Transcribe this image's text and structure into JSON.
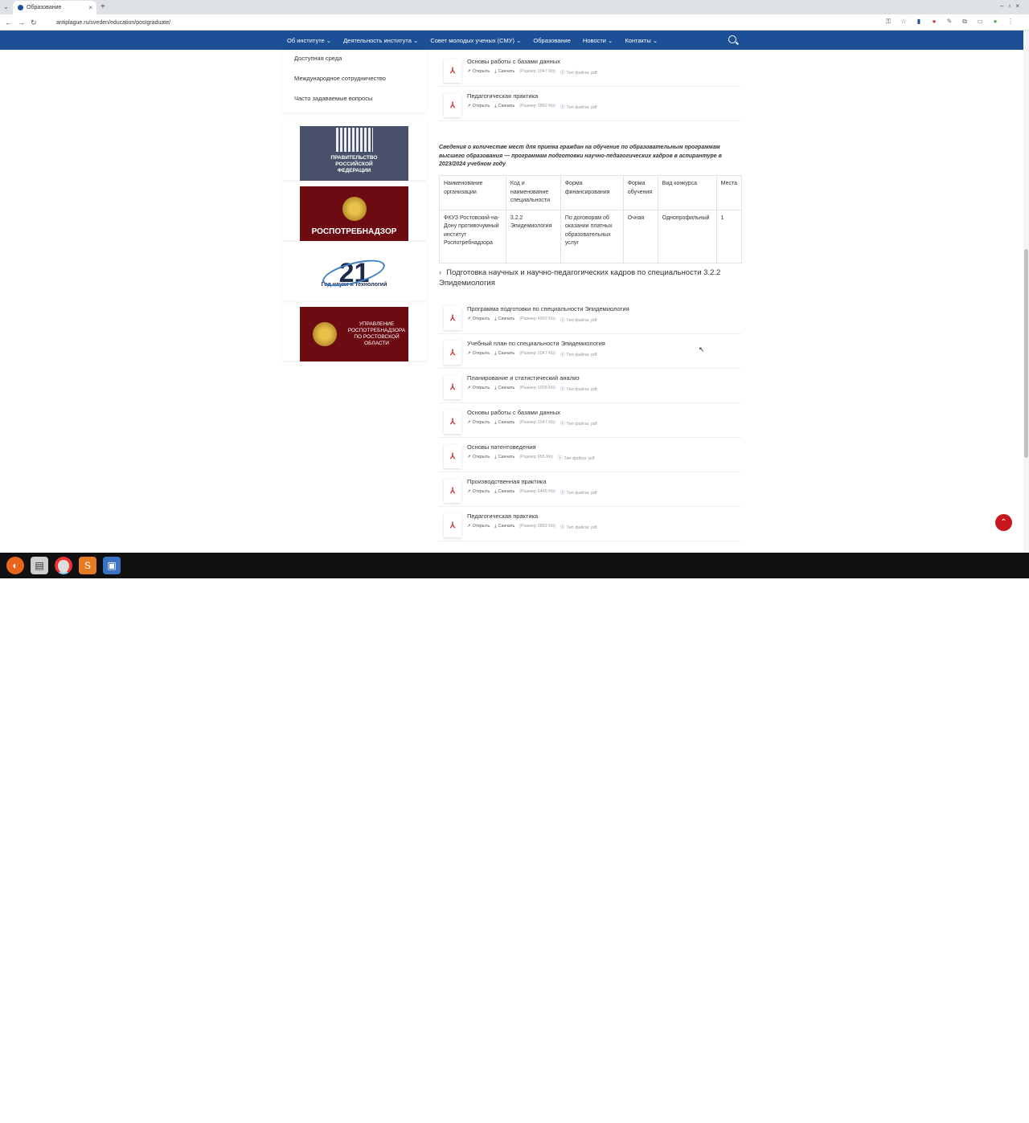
{
  "browser": {
    "tab_title": "Образование",
    "url": "antiplague.ru/sveden/education/postgraduate/"
  },
  "nav": {
    "items": [
      "Об институте",
      "Деятельность института",
      "Совет молодых ученых (СМУ)",
      "Образование",
      "Новости",
      "Контакты"
    ],
    "dropdown_flags": [
      true,
      true,
      true,
      false,
      true,
      true
    ]
  },
  "sidebar": {
    "links": [
      "Доступная среда",
      "Международное сотрудничество",
      "Часто задаваемые вопросы"
    ]
  },
  "banners": {
    "gov": "ПРАВИТЕЛЬСТВО РОССИЙСКОЙ ФЕДЕРАЦИИ",
    "rpn": "РОСПОТРЕБНАДЗОР",
    "year_num": "21",
    "year_text": "Год науки и технологий",
    "upr": "УПРАВЛЕНИЕ РОСПОТРЕБНАДЗОРА ПО РОСТОВСКОЙ ОБЛАСТИ"
  },
  "labels": {
    "open": "Открыть",
    "download": "Скачать",
    "type": "Тип файла: pdf"
  },
  "files_top": [
    {
      "title": "Основы работы с базами данных",
      "size": "(Размер 1047 Kb)"
    },
    {
      "title": "Педагогическая практика",
      "size": "(Размер 3892 Kb)"
    }
  ],
  "note": "Сведения о количестве мест для приема граждан на обучение по образовательным программам высшего образования — программам подготовки научно-педагогических кадров в аспирантуре в 2023/2024 учебном году",
  "table": {
    "headers": [
      "Наименование организации",
      "Код и наименование специальности",
      "Форма финансирования",
      "Форма обучения",
      "Вид конкурса",
      "Места"
    ],
    "row": [
      "ФКУЗ Ростовский-на-Дону противочумный институт Роспотребнадзора",
      "3.2.2 Эпидемиология",
      "По договорам об оказании платных образовательных услуг",
      "Очная",
      "Однопрофильный",
      "1"
    ]
  },
  "section_title": "Подготовка научных и научно-педагогических кадров по специальности 3.2.2 Эпидемиология",
  "files": [
    {
      "title": "Программа подготовки по специальности Эпидемиология",
      "size": "(Размер 4992 Kb)"
    },
    {
      "title": "Учебный план по специальности Эпидемиология",
      "size": "(Размер 1047 Kb)"
    },
    {
      "title": "Планирование и статистический анализ",
      "size": "(Размер 1008 Kb)"
    },
    {
      "title": "Основы работы с базами данных",
      "size": "(Размер 1047 Kb)"
    },
    {
      "title": "Основы патентоведения",
      "size": "(Размер 955 Kb)"
    },
    {
      "title": "Производственная практика",
      "size": "(Размер 6446 Kb)"
    },
    {
      "title": "Педагогическая практика",
      "size": "(Размер 3892 Kb)"
    }
  ],
  "colors": {
    "nav_bg": "#1c4f96",
    "accent_red": "#c8161d",
    "banner_red": "#6c0c12"
  }
}
